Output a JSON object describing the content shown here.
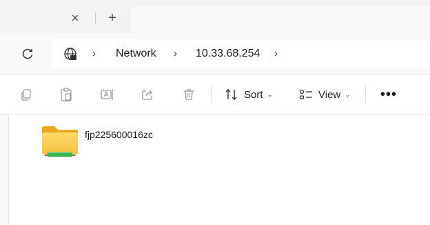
{
  "tabbar": {
    "close_glyph": "×",
    "new_tab_glyph": "+"
  },
  "address": {
    "refresh_icon": "refresh-icon",
    "location_icon": "network-globe-icon",
    "separator": "›",
    "crumbs": [
      "Network",
      "10.33.68.254"
    ]
  },
  "toolbar": {
    "icons": [
      "copy-icon",
      "paste-icon",
      "rename-icon",
      "share-icon",
      "delete-icon"
    ],
    "sort_label": "Sort",
    "view_label": "View",
    "dropdown_glyph": "⌄",
    "more_glyph": "•••"
  },
  "content": {
    "items": [
      {
        "name": "fjp225600016zc",
        "icon": "network-share-folder-icon"
      }
    ]
  },
  "colors": {
    "tabbar_bg": "#f3f3f3",
    "addrbar_bg": "#f9f9f9",
    "folder_yellow": "#f7c948",
    "share_green": "#35b34a"
  }
}
